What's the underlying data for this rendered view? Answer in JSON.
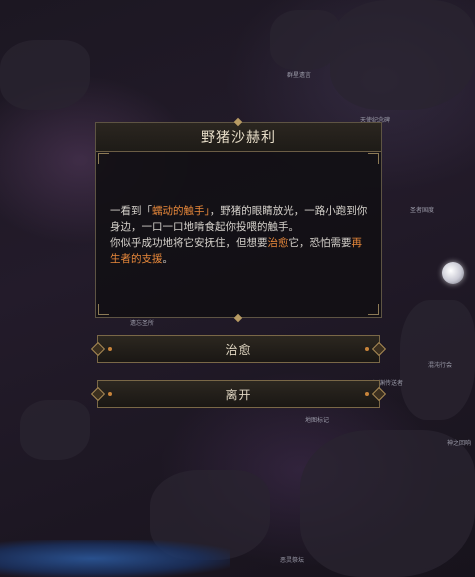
{
  "dialog": {
    "title": "野猪沙赫利",
    "line1_a": "一看到「",
    "line1_highlight": "蠕动的触手」",
    "line1_b": "，野猪的眼睛放光，一路小跑到你身边，一口一口地啃食起你投喂的触手。",
    "line2_a": "你似乎成功地将它安抚住，但想要",
    "line2_highlight": "治愈",
    "line2_b": "它，恐怕需要",
    "line2_highlight2": "再生者的支援",
    "line2_end": "。"
  },
  "buttons": {
    "heal_label": "治愈",
    "leave_label": "离开"
  },
  "map_labels": {
    "label_1": "群星遗言",
    "label_2": "天使纪念碑",
    "label_3": "圣者国度",
    "label_4": "混沌行会",
    "label_5": "深渊传送者",
    "label_6": "神之回响",
    "label_7": "地图标记",
    "label_8": "遗忘圣所",
    "label_9": "恶灵祭坛"
  },
  "colors": {
    "highlight": "#e8883a",
    "frame": "#7a6847"
  }
}
